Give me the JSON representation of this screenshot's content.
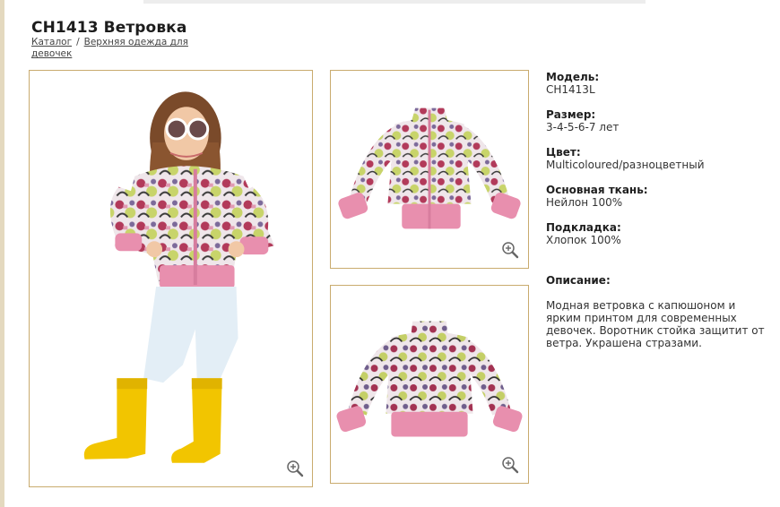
{
  "product": {
    "title": "CH1413 Ветровка"
  },
  "breadcrumb": {
    "catalog": "Каталог",
    "separator": "/",
    "category": "Верхняя одежда для девочек"
  },
  "images": {
    "main_alt": "Девочка в ветровке CH1413",
    "front_alt": "Ветровка CH1413, вид спереди",
    "back_alt": "Ветровка CH1413, вид сзади",
    "zoom_icon": "magnifier-plus"
  },
  "specs": [
    {
      "label": "Модель:",
      "value": "CH1413L"
    },
    {
      "label": "Размер:",
      "value": "3-4-5-6-7 лет"
    },
    {
      "label": "Цвет:",
      "value": "Multicoloured/разноцветный"
    },
    {
      "label": "Основная ткань:",
      "value": "Нейлон 100%"
    },
    {
      "label": "Подкладка:",
      "value": "Хлопок 100%"
    }
  ],
  "description": {
    "label": "Описание:",
    "text": "Модная ветровка с капюшоном и ярким принтом для современных девочек. Воротник стойка защитит от ветра. Украшена стразами."
  },
  "colors": {
    "frame_border": "#c9ab6e",
    "cuff_pink": "#e88fae",
    "boot_yellow": "#f2c500",
    "jeans": "#e3eef6"
  }
}
